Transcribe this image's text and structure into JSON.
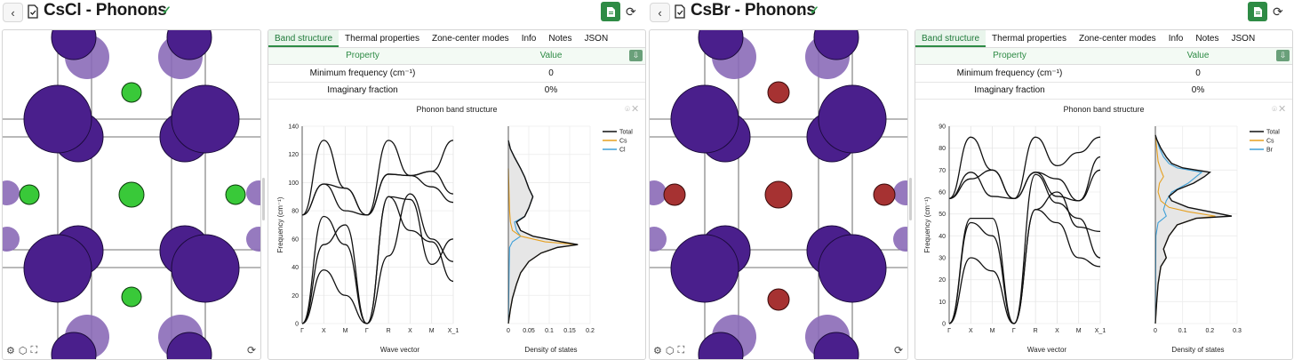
{
  "panels": [
    {
      "title": "CsCl - Phonons",
      "tabs": [
        "Band structure",
        "Thermal properties",
        "Zone-center modes",
        "Info",
        "Notes",
        "JSON"
      ],
      "table": {
        "header_property": "Property",
        "header_value": "Value",
        "rows": [
          {
            "property": "Minimum frequency (cm⁻¹)",
            "value": "0"
          },
          {
            "property": "Imaginary fraction",
            "value": "0%"
          }
        ]
      },
      "small_atom_color": "#39c939",
      "chart_data": {
        "type": "line",
        "title": "Phonon band structure",
        "xlabel": "Wave vector",
        "ylabel": "Frequency (cm⁻¹)",
        "ylim": [
          0,
          140
        ],
        "yticks": [
          0,
          20,
          40,
          60,
          80,
          100,
          120,
          140
        ],
        "kpoints": [
          "Γ",
          "X",
          "M",
          "Γ",
          "R",
          "X",
          "M",
          "X_1"
        ],
        "dos_xlabel": "Density of states",
        "dos_xticks": [
          "0",
          "0.05",
          "0.1",
          "0.15",
          "0.2"
        ],
        "dos_xmax": 0.2,
        "legend": [
          "Total",
          "Cs",
          "Cl"
        ],
        "series_colors": [
          "#111111",
          "#e6a020",
          "#3fa0d8"
        ],
        "bands": [
          [
            0,
            38,
            20,
            0,
            48,
            92,
            60,
            44
          ],
          [
            0,
            56,
            70,
            0,
            90,
            88,
            42,
            60
          ],
          [
            0,
            76,
            56,
            0,
            90,
            66,
            58,
            30
          ],
          [
            77,
            99,
            96,
            77,
            106,
            105,
            97,
            86
          ],
          [
            77,
            99,
            80,
            77,
            106,
            105,
            108,
            92
          ],
          [
            77,
            130,
            96,
            77,
            130,
            105,
            108,
            130
          ]
        ],
        "dos_total": [
          [
            0,
            0
          ],
          [
            0.005,
            10
          ],
          [
            0.01,
            18
          ],
          [
            0.02,
            28
          ],
          [
            0.03,
            36
          ],
          [
            0.05,
            44
          ],
          [
            0.08,
            50
          ],
          [
            0.12,
            54
          ],
          [
            0.17,
            56
          ],
          [
            0.13,
            58
          ],
          [
            0.06,
            62
          ],
          [
            0.03,
            66
          ],
          [
            0.02,
            72
          ],
          [
            0.04,
            76
          ],
          [
            0.05,
            82
          ],
          [
            0.06,
            90
          ],
          [
            0.05,
            96
          ],
          [
            0.04,
            104
          ],
          [
            0.03,
            110
          ],
          [
            0.015,
            118
          ],
          [
            0.005,
            124
          ],
          [
            0,
            130
          ]
        ],
        "dos_cs": [
          [
            0,
            0
          ],
          [
            0.005,
            10
          ],
          [
            0.01,
            18
          ],
          [
            0.02,
            28
          ],
          [
            0.03,
            36
          ],
          [
            0.05,
            44
          ],
          [
            0.08,
            50
          ],
          [
            0.12,
            54
          ],
          [
            0.17,
            56
          ],
          [
            0.09,
            58
          ],
          [
            0.03,
            62
          ],
          [
            0.01,
            66
          ],
          [
            0.005,
            72
          ],
          [
            0.003,
            80
          ],
          [
            0.002,
            90
          ],
          [
            0.001,
            100
          ],
          [
            0,
            110
          ]
        ],
        "dos_x": [
          [
            0,
            0
          ],
          [
            0.001,
            20
          ],
          [
            0.002,
            40
          ],
          [
            0.003,
            54
          ],
          [
            0.01,
            58
          ],
          [
            0.03,
            62
          ],
          [
            0.02,
            66
          ],
          [
            0.015,
            72
          ],
          [
            0.04,
            76
          ],
          [
            0.05,
            82
          ],
          [
            0.06,
            90
          ],
          [
            0.05,
            96
          ],
          [
            0.04,
            104
          ],
          [
            0.03,
            110
          ],
          [
            0.015,
            118
          ],
          [
            0.005,
            124
          ],
          [
            0,
            130
          ]
        ]
      }
    },
    {
      "title": "CsBr - Phonons",
      "tabs": [
        "Band structure",
        "Thermal properties",
        "Zone-center modes",
        "Info",
        "Notes",
        "JSON"
      ],
      "table": {
        "header_property": "Property",
        "header_value": "Value",
        "rows": [
          {
            "property": "Minimum frequency (cm⁻¹)",
            "value": "0"
          },
          {
            "property": "Imaginary fraction",
            "value": "0%"
          }
        ]
      },
      "small_atom_color": "#a63232",
      "chart_data": {
        "type": "line",
        "title": "Phonon band structure",
        "xlabel": "Wave vector",
        "ylabel": "Frequency (cm⁻¹)",
        "ylim": [
          0,
          90
        ],
        "yticks": [
          0,
          10,
          20,
          30,
          40,
          50,
          60,
          70,
          80,
          90
        ],
        "kpoints": [
          "Γ",
          "X",
          "M",
          "Γ",
          "R",
          "X",
          "M",
          "X_1"
        ],
        "dos_xlabel": "Density of states",
        "dos_xticks": [
          "0",
          "0.1",
          "0.2",
          "0.3"
        ],
        "dos_xmax": 0.3,
        "legend": [
          "Total",
          "Cs",
          "Br"
        ],
        "series_colors": [
          "#111111",
          "#e6a020",
          "#3fa0d8"
        ],
        "bands": [
          [
            0,
            30,
            24,
            0,
            52,
            46,
            30,
            26
          ],
          [
            0,
            48,
            48,
            0,
            52,
            60,
            44,
            42
          ],
          [
            0,
            46,
            40,
            0,
            68,
            55,
            48,
            30
          ],
          [
            57,
            69,
            58,
            57,
            69,
            66,
            56,
            70
          ],
          [
            57,
            66,
            70,
            57,
            69,
            58,
            56,
            76
          ],
          [
            57,
            85,
            70,
            57,
            85,
            72,
            78,
            85
          ]
        ],
        "dos_total": [
          [
            0,
            0
          ],
          [
            0.005,
            10
          ],
          [
            0.01,
            18
          ],
          [
            0.02,
            26
          ],
          [
            0.04,
            30
          ],
          [
            0.03,
            34
          ],
          [
            0.05,
            40
          ],
          [
            0.08,
            45
          ],
          [
            0.15,
            48
          ],
          [
            0.28,
            49
          ],
          [
            0.2,
            51
          ],
          [
            0.12,
            53
          ],
          [
            0.06,
            56
          ],
          [
            0.05,
            58
          ],
          [
            0.08,
            61
          ],
          [
            0.14,
            64
          ],
          [
            0.18,
            67
          ],
          [
            0.2,
            69
          ],
          [
            0.1,
            71
          ],
          [
            0.06,
            73
          ],
          [
            0.04,
            76
          ],
          [
            0.02,
            80
          ],
          [
            0.005,
            84
          ],
          [
            0,
            86
          ]
        ],
        "dos_cs": [
          [
            0,
            0
          ],
          [
            0.005,
            10
          ],
          [
            0.01,
            18
          ],
          [
            0.02,
            26
          ],
          [
            0.04,
            30
          ],
          [
            0.03,
            34
          ],
          [
            0.05,
            40
          ],
          [
            0.08,
            45
          ],
          [
            0.15,
            48
          ],
          [
            0.22,
            49
          ],
          [
            0.12,
            51
          ],
          [
            0.05,
            53
          ],
          [
            0.02,
            56
          ],
          [
            0.01,
            60
          ],
          [
            0.015,
            64
          ],
          [
            0.03,
            67
          ],
          [
            0.02,
            70
          ],
          [
            0.01,
            74
          ],
          [
            0.005,
            80
          ],
          [
            0,
            86
          ]
        ],
        "dos_x": [
          [
            0,
            0
          ],
          [
            0.001,
            20
          ],
          [
            0.002,
            40
          ],
          [
            0.01,
            46
          ],
          [
            0.04,
            49
          ],
          [
            0.03,
            52
          ],
          [
            0.04,
            56
          ],
          [
            0.06,
            60
          ],
          [
            0.12,
            64
          ],
          [
            0.15,
            67
          ],
          [
            0.17,
            69
          ],
          [
            0.08,
            71
          ],
          [
            0.05,
            73
          ],
          [
            0.03,
            76
          ],
          [
            0.015,
            80
          ],
          [
            0.005,
            84
          ],
          [
            0,
            86
          ]
        ]
      }
    }
  ]
}
